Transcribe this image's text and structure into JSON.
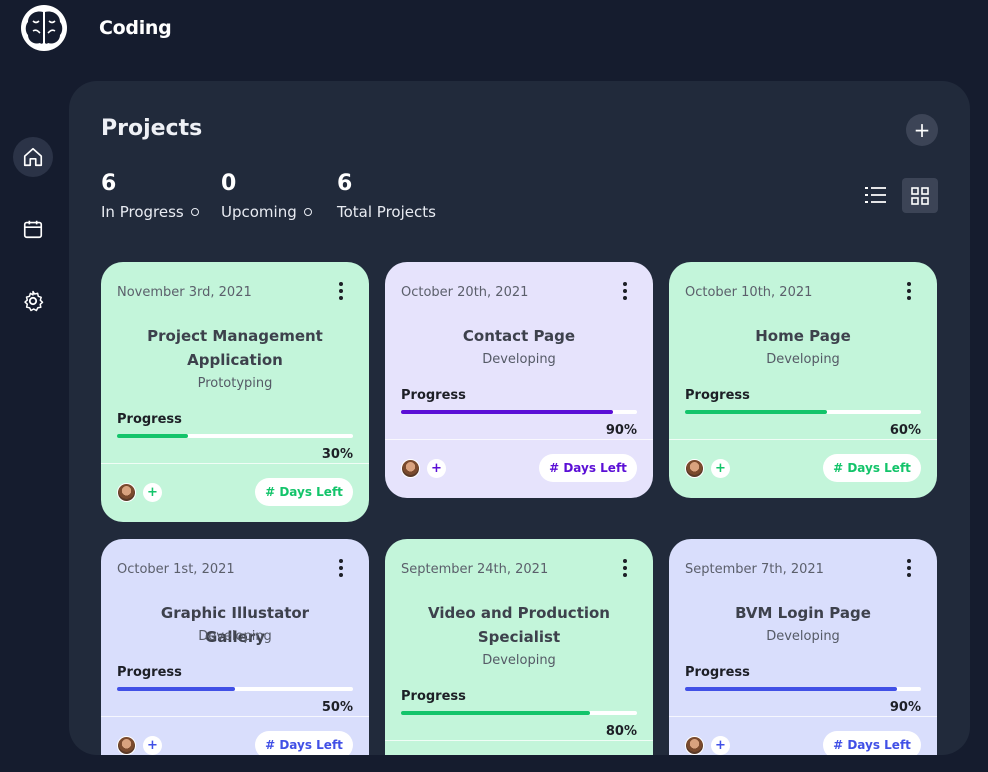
{
  "app": {
    "title": "Coding"
  },
  "sidebar": {
    "items": [
      {
        "name": "home",
        "icon": "home-icon",
        "active": true
      },
      {
        "name": "calendar",
        "icon": "calendar-icon",
        "active": false
      },
      {
        "name": "settings",
        "icon": "gear-icon",
        "active": false
      }
    ]
  },
  "header": {
    "title": "Projects",
    "add_icon": "plus-icon"
  },
  "stats": [
    {
      "value": "6",
      "label": "In Progress"
    },
    {
      "value": "0",
      "label": "Upcoming"
    },
    {
      "value": "6",
      "label": "Total Projects"
    }
  ],
  "view_toggle": {
    "list_icon": "list-view-icon",
    "grid_icon": "grid-view-icon",
    "active": "grid"
  },
  "progress_label": "Progress",
  "days_left_label": "# Days Left",
  "projects": [
    {
      "date": "November 3rd, 2021",
      "title": "Project Management Application",
      "status": "Prototyping",
      "progress": 30,
      "progress_text": "30%",
      "bg": "#c3f5da",
      "accent": "#13c46a"
    },
    {
      "date": "October 20th, 2021",
      "title": "Contact Page",
      "status": "Developing",
      "progress": 90,
      "progress_text": "90%",
      "bg": "#e6e3fc",
      "accent": "#5b0fd6"
    },
    {
      "date": "October 10th, 2021",
      "title": "Home Page",
      "status": "Developing",
      "progress": 60,
      "progress_text": "60%",
      "bg": "#c3f5da",
      "accent": "#13c46a"
    },
    {
      "date": "October 1st, 2021",
      "title": "Graphic Illustator Gallery",
      "status": "Developing",
      "progress": 50,
      "progress_text": "50%",
      "bg": "#d9defc",
      "accent": "#4150e6"
    },
    {
      "date": "September 24th, 2021",
      "title": "Video and Production Specialist",
      "status": "Developing",
      "progress": 80,
      "progress_text": "80%",
      "bg": "#c3f5da",
      "accent": "#13c46a"
    },
    {
      "date": "September 7th, 2021",
      "title": "BVM Login Page",
      "status": "Developing",
      "progress": 90,
      "progress_text": "90%",
      "bg": "#d9defc",
      "accent": "#4150e6"
    }
  ]
}
